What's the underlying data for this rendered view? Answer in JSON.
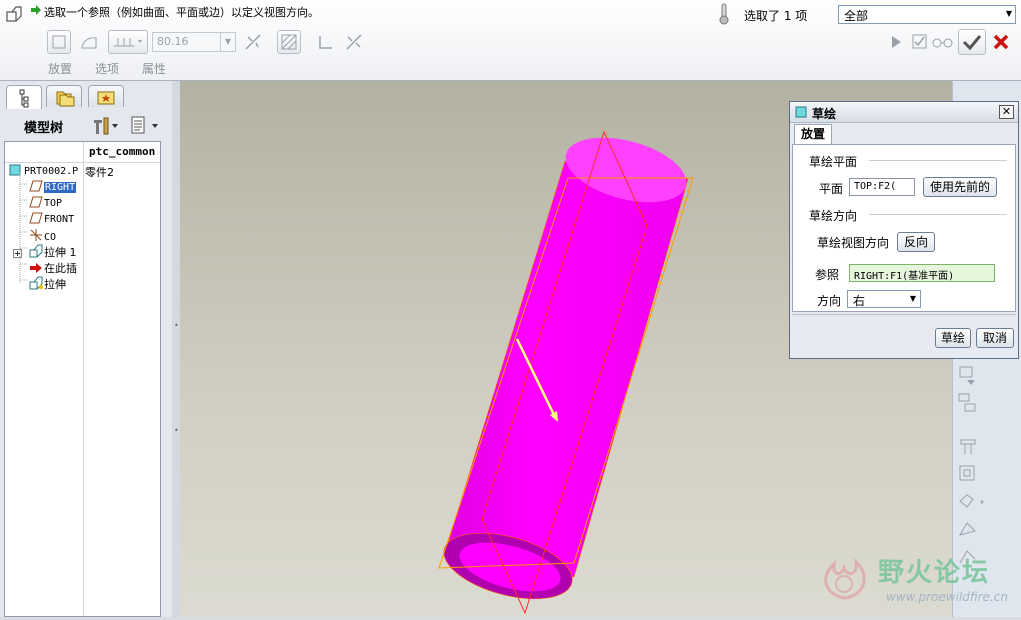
{
  "dashboard": {
    "message": "选取一个参照（例如曲面、平面或边）以定义视图方向。",
    "value_field": "80.16",
    "tabs": [
      "放置",
      "选项",
      "属性"
    ],
    "selection_status": "选取了 1 项",
    "filter_value": "全部"
  },
  "model_tree": {
    "title": "模型树",
    "column_header": "ptc_common",
    "items": [
      {
        "label": "PRT0002.P",
        "value": "零件2"
      },
      {
        "label": "RIGHT",
        "value": ""
      },
      {
        "label": "TOP",
        "value": ""
      },
      {
        "label": "FRONT",
        "value": ""
      },
      {
        "label": "CO",
        "value": ""
      },
      {
        "label": "拉伸 1",
        "value": ""
      },
      {
        "label": "在此插",
        "value": ""
      },
      {
        "label": "拉伸",
        "value": ""
      }
    ]
  },
  "dialog": {
    "title": "草绘",
    "tab": "放置",
    "section_plane": "草绘平面",
    "plane_label": "平面",
    "plane_value": "TOP:F2(",
    "use_previous_button": "使用先前的",
    "section_orientation": "草绘方向",
    "view_direction_label": "草绘视图方向",
    "flip_button": "反向",
    "reference_label": "参照",
    "reference_value": "RIGHT:F1(基准平面)",
    "direction_label": "方向",
    "direction_value": "右",
    "sketch_button": "草绘",
    "cancel_button": "取消"
  },
  "watermark": {
    "text": "野火论坛",
    "url": "www.proewildfire.cn"
  },
  "colors": {
    "cylinder": "#ff00ff",
    "datum_plane": "#ff2a2a",
    "selection_box": "#ff9a00",
    "viewport_top": "#b3b2a2"
  }
}
